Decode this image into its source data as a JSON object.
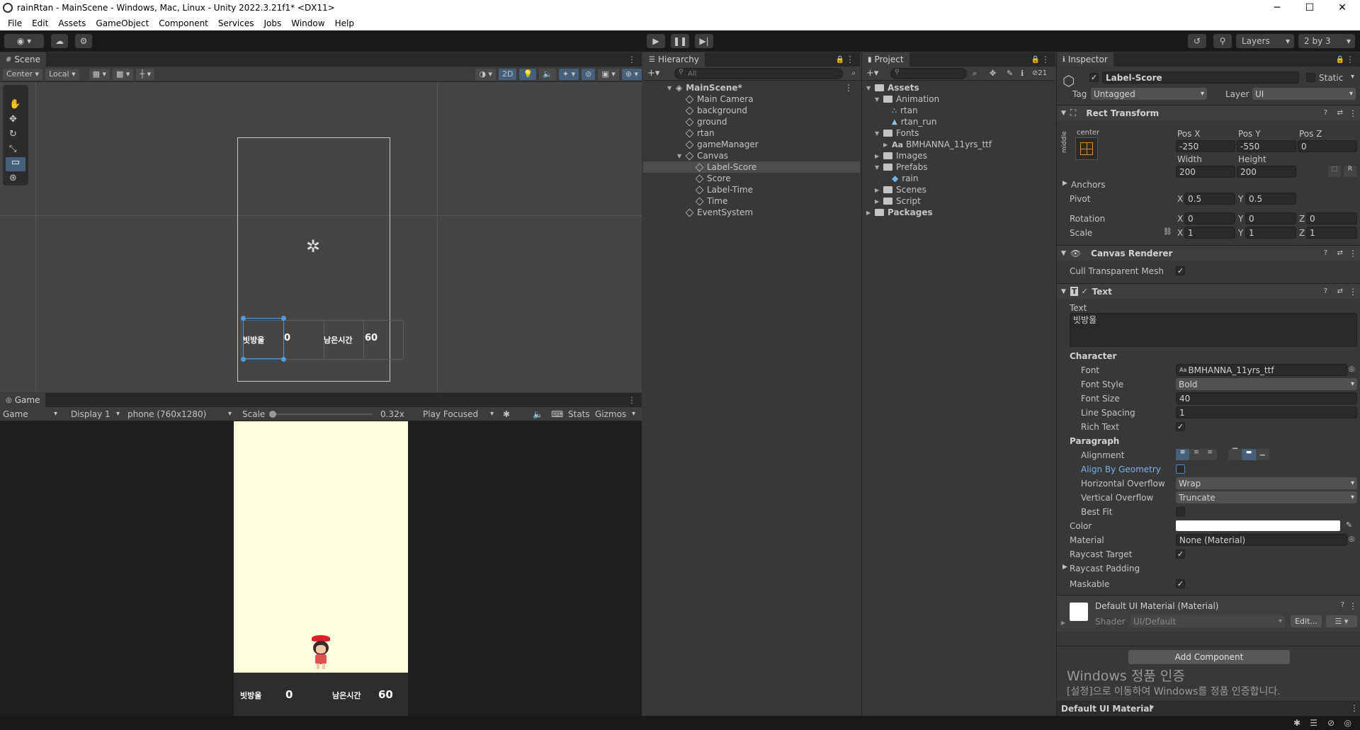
{
  "window": {
    "title": "rainRtan - MainScene - Windows, Mac, Linux - Unity 2022.3.21f1* <DX11>",
    "minimize": "─",
    "maximize": "☐",
    "close": "✕"
  },
  "menu": [
    "File",
    "Edit",
    "Assets",
    "GameObject",
    "Component",
    "Services",
    "Jobs",
    "Window",
    "Help"
  ],
  "toolbar": {
    "layers": "Layers",
    "layout": "2 by 3"
  },
  "scene": {
    "tab": "Scene",
    "pivot": "Center",
    "space": "Local",
    "mode2d": "2D",
    "ui_labels": {
      "score_label": "빗방울",
      "score": "0",
      "time_label": "남은시간",
      "time": "60"
    }
  },
  "game": {
    "tab": "Game",
    "view": "Game",
    "display": "Display 1",
    "resolution": "phone (760x1280)",
    "scale_label": "Scale",
    "scale_value": "0.32x",
    "play_mode": "Play Focused",
    "stats": "Stats",
    "gizmos": "Gizmos",
    "hud": {
      "score_label": "빗방울",
      "score": "0",
      "time_label": "남은시간",
      "time": "60"
    }
  },
  "hierarchy": {
    "tab": "Hierarchy",
    "search_placeholder": "All",
    "items": [
      {
        "label": "MainScene*",
        "depth": 0
      },
      {
        "label": "Main Camera",
        "depth": 1
      },
      {
        "label": "background",
        "depth": 1
      },
      {
        "label": "ground",
        "depth": 1
      },
      {
        "label": "rtan",
        "depth": 1
      },
      {
        "label": "gameManager",
        "depth": 1
      },
      {
        "label": "Canvas",
        "depth": 1
      },
      {
        "label": "Label-Score",
        "depth": 2,
        "selected": true
      },
      {
        "label": "Score",
        "depth": 2
      },
      {
        "label": "Label-Time",
        "depth": 2
      },
      {
        "label": "Time",
        "depth": 2
      },
      {
        "label": "EventSystem",
        "depth": 1
      }
    ]
  },
  "project": {
    "tab": "Project",
    "hidden_count": "21",
    "items": [
      {
        "label": "Assets",
        "depth": 0,
        "kind": "folder"
      },
      {
        "label": "Animation",
        "depth": 1,
        "kind": "folder"
      },
      {
        "label": "rtan",
        "depth": 2,
        "kind": "anim"
      },
      {
        "label": "rtan_run",
        "depth": 2,
        "kind": "anim"
      },
      {
        "label": "Fonts",
        "depth": 1,
        "kind": "folder"
      },
      {
        "label": "BMHANNA_11yrs_ttf",
        "depth": 2,
        "kind": "font"
      },
      {
        "label": "Images",
        "depth": 1,
        "kind": "folder"
      },
      {
        "label": "Prefabs",
        "depth": 1,
        "kind": "folder"
      },
      {
        "label": "rain",
        "depth": 2,
        "kind": "prefab"
      },
      {
        "label": "Scenes",
        "depth": 1,
        "kind": "folder"
      },
      {
        "label": "Script",
        "depth": 1,
        "kind": "folder"
      },
      {
        "label": "Packages",
        "depth": 0,
        "kind": "folder"
      }
    ]
  },
  "inspector": {
    "tab": "Inspector",
    "object_name": "Label-Score",
    "static_label": "Static",
    "tag_label": "Tag",
    "tag": "Untagged",
    "layer_label": "Layer",
    "layer": "UI",
    "rect_transform": {
      "title": "Rect Transform",
      "anchor_h": "center",
      "anchor_v": "middle",
      "posx_label": "Pos X",
      "posx": "-250",
      "posy_label": "Pos Y",
      "posy": "-550",
      "posz_label": "Pos Z",
      "posz": "0",
      "width_label": "Width",
      "width": "200",
      "height_label": "Height",
      "height": "200",
      "anchors": "Anchors",
      "pivot_label": "Pivot",
      "pivot_x": "0.5",
      "pivot_y": "0.5",
      "rotation_label": "Rotation",
      "rot_x": "0",
      "rot_y": "0",
      "rot_z": "0",
      "scale_label": "Scale",
      "scale_x": "1",
      "scale_y": "1",
      "scale_z": "1",
      "x": "X",
      "y": "Y",
      "z": "Z"
    },
    "canvas_renderer": {
      "title": "Canvas Renderer",
      "cull_label": "Cull Transparent Mesh"
    },
    "text": {
      "title": "Text",
      "text_label": "Text",
      "text_value": "빗방울",
      "character": "Character",
      "font_label": "Font",
      "font": "BMHANNA_11yrs_ttf",
      "font_style_label": "Font Style",
      "font_style": "Bold",
      "font_size_label": "Font Size",
      "font_size": "40",
      "line_spacing_label": "Line Spacing",
      "line_spacing": "1",
      "rich_text_label": "Rich Text",
      "paragraph": "Paragraph",
      "alignment_label": "Alignment",
      "align_geom_label": "Align By Geometry",
      "h_overflow_label": "Horizontal Overflow",
      "h_overflow": "Wrap",
      "v_overflow_label": "Vertical Overflow",
      "v_overflow": "Truncate",
      "best_fit_label": "Best Fit",
      "color_label": "Color",
      "color": "#ffffff",
      "material_label": "Material",
      "material": "None (Material)",
      "raycast_target_label": "Raycast Target",
      "raycast_padding_label": "Raycast Padding",
      "maskable_label": "Maskable"
    },
    "material": {
      "title": "Default UI Material (Material)",
      "shader_label": "Shader",
      "shader": "UI/Default",
      "edit": "Edit..."
    },
    "add_component": "Add Component",
    "watermark_title": "Windows 정품 인증",
    "watermark_sub": "[설정]으로 이동하여 Windows를 정품 인증합니다.",
    "footer": "Default UI Material"
  },
  "colors": {
    "selection": "#4d4d4d",
    "accent_blue": "#46607c",
    "game_bg": "#ffffe0",
    "game_ground": "#2d2d2d"
  }
}
